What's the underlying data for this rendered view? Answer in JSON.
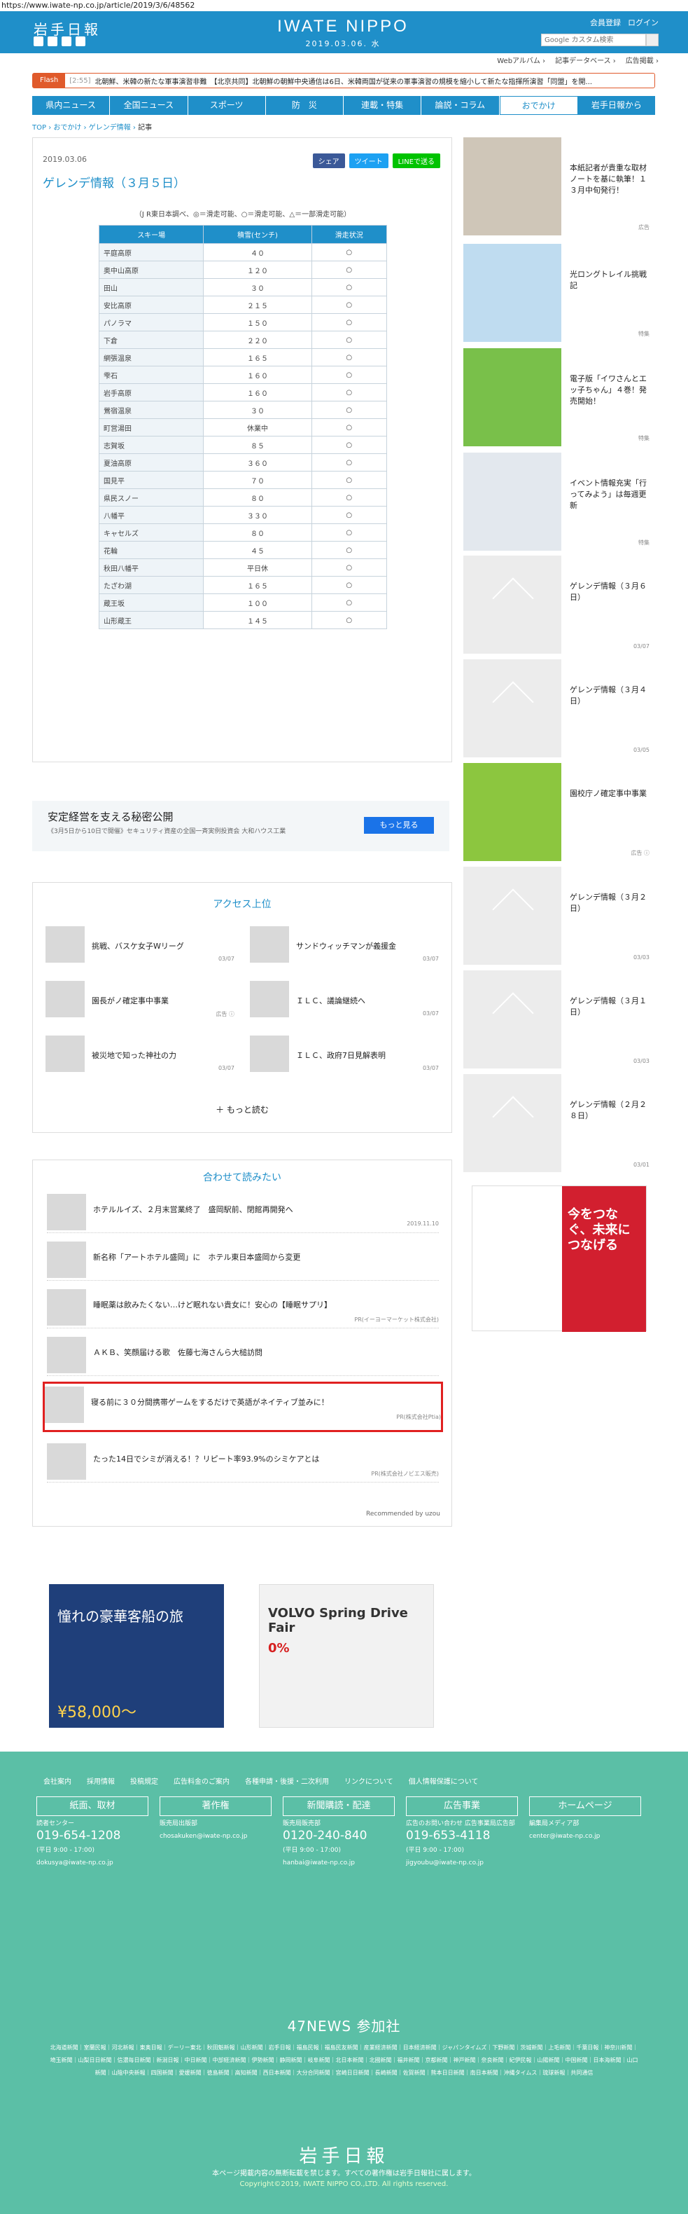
{
  "url": "https://www.iwate-np.co.jp/article/2019/3/6/48562",
  "header": {
    "logo": "岩手日報",
    "brand": "IWATE NIPPO",
    "date": "2019.03.06. 水",
    "member": "会員登録",
    "login": "ログイン",
    "search_placeholder": "Google カスタム検索",
    "subnav": [
      "Webアルバム ›",
      "記事データベース ›",
      "広告掲載 ›"
    ]
  },
  "flash": {
    "tag": "Flash",
    "time": "[2:55]",
    "text": "北朝鮮、米韓の新たな軍事演習非難　【北京共同】北朝鮮の朝鮮中央通信は6日、米韓両国が従来の軍事演習の規模を縮小して新たな指揮所演習「同盟」を開..."
  },
  "nav": [
    "県内ニュース",
    "全国ニュース",
    "スポーツ",
    "防　災",
    "連載・特集",
    "論説・コラム",
    "おでかけ",
    "岩手日報から"
  ],
  "breadcrumb": [
    "TOP",
    "おでかけ",
    "ゲレンデ情報",
    "記事"
  ],
  "article": {
    "date": "2019.03.06",
    "title": "ゲレンデ情報（３月５日）",
    "share": [
      "シェア",
      "ツイート",
      "LINEで送る"
    ],
    "note": "（J R東日本調べ、◎＝滑走可能、○＝滑走可能、△＝一部滑走可能）",
    "columns": [
      "スキー場",
      "積雪(センチ)",
      "滑走状況"
    ],
    "rows": [
      [
        "平庭高原",
        "４０",
        "○"
      ],
      [
        "奥中山高原",
        "１２０",
        "○"
      ],
      [
        "田山",
        "３０",
        "○"
      ],
      [
        "安比高原",
        "２１５",
        "○"
      ],
      [
        "パノラマ",
        "１５０",
        "○"
      ],
      [
        "下倉",
        "２２０",
        "○"
      ],
      [
        "網張温泉",
        "１６５",
        "○"
      ],
      [
        "雫石",
        "１６０",
        "○"
      ],
      [
        "岩手高原",
        "１６０",
        "○"
      ],
      [
        "鶯宿温泉",
        "３０",
        "○"
      ],
      [
        "町営湯田",
        "休業中",
        "○"
      ],
      [
        "志賀坂",
        "８５",
        "○"
      ],
      [
        "夏油高原",
        "３６０",
        "○"
      ],
      [
        "国見平",
        "７０",
        "○"
      ],
      [
        "県民スノー",
        "８０",
        "○"
      ],
      [
        "八幡平",
        "３３０",
        "○"
      ],
      [
        "キャセルズ",
        "８０",
        "○"
      ],
      [
        "花輪",
        "４５",
        "○"
      ],
      [
        "秋田八幡平",
        "平日休",
        "○"
      ],
      [
        "たざわ湖",
        "１６５",
        "○"
      ],
      [
        "蔵王坂",
        "１００",
        "○"
      ],
      [
        "山形蔵王",
        "１４５",
        "○"
      ]
    ]
  },
  "ad": {
    "headline": "安定経営を支える秘密公開",
    "sub": "《3月5日から10日で開催》セキュリティ資産の全国一斉実例投資会 大和ハウス工業",
    "cta": "もっと見る"
  },
  "ranking": {
    "title": "アクセス上位",
    "items": [
      {
        "title": "挑戦、バスケ女子Wリーグ",
        "date": "03/07"
      },
      {
        "title": "サンドウィッチマンが義援金",
        "date": "03/07"
      },
      {
        "title": "園長がノ確定事中事業",
        "date": "広告 ⓘ"
      },
      {
        "title": "ＩＬＣ、議論継続へ",
        "date": "03/07"
      },
      {
        "title": "被災地で知った神社の力",
        "date": "03/07"
      },
      {
        "title": "ＩＬＣ、政府7日見解表明",
        "date": "03/07"
      }
    ],
    "more": "＋ もっと読む"
  },
  "related": {
    "title": "合わせて読みたい",
    "items": [
      {
        "title": "ホテルルイズ、２月末営業終了　盛岡駅前、閉館再開発へ",
        "src": "2019.11.10"
      },
      {
        "title": "新名称「アートホテル盛岡」に　ホテル東日本盛岡から変更",
        "src": ""
      },
      {
        "title": "睡眠薬は飲みたくない…けど眠れない貴女に！安心の【睡眠サプリ】",
        "src": "PR(イーヨーマーケット株式会社)"
      },
      {
        "title": "ＡＫＢ、笑顔届ける歌　佐藤七海さんら大槌訪問",
        "src": ""
      },
      {
        "title": "寝る前に３０分間携帯ゲームをするだけで英語がネイティブ並みに！",
        "src": "PR(株式会社Ptia)"
      },
      {
        "title": "たった14日でシミが消える！？リピート率93.9%のシミケアとは",
        "src": "PR(株式会社ノビエス販売)"
      }
    ],
    "powered": "Recommended by uzou"
  },
  "bottom_ads": [
    {
      "title": "憧れの豪華客船の旅",
      "price": "¥58,000〜"
    },
    {
      "title": "VOLVO Spring Drive Fair",
      "price": "0%"
    }
  ],
  "sidebar": [
    {
      "title": "本紙記者が貴重な取材ノートを基に執筆！１３月中旬発行！",
      "meta": "広告"
    },
    {
      "title": "光ロングトレイル挑戦記",
      "meta": "特集"
    },
    {
      "title": "電子版「イワさんとエッ子ちゃん」４巻！発売開始！",
      "meta": "特集"
    },
    {
      "title": "イベント情報充実「行ってみよう」は毎週更新",
      "meta": "特集"
    },
    {
      "title": "ゲレンデ情報（３月６日）",
      "meta": "03/07"
    },
    {
      "title": "ゲレンデ情報（３月４日）",
      "meta": "03/05"
    },
    {
      "title": "園校庁ノ確定事中事業",
      "meta": "広告 ⓘ"
    },
    {
      "title": "ゲレンデ情報（３月２日）",
      "meta": "03/03"
    },
    {
      "title": "ゲレンデ情報（３月１日）",
      "meta": "03/03"
    },
    {
      "title": "ゲレンデ情報（２月２８日）",
      "meta": "03/01"
    }
  ],
  "side_ad": {
    "text": "今をつなぐ、未来につなげる"
  },
  "footer": {
    "links": [
      "会社案内",
      "採用情報",
      "投稿規定",
      "広告料金のご案内",
      "各種申請・後援・二次利用",
      "リンクについて",
      "個人情報保護について"
    ],
    "cols": [
      {
        "h": "紙面、取材",
        "b": "読者センター",
        "tel": "019-654-1208",
        "sub": "(平日 9:00 - 17:00)",
        "mail": "dokusya@iwate-np.co.jp"
      },
      {
        "h": "著作権",
        "b": "販売局出版部",
        "tel": "",
        "sub": "",
        "mail": "chosakuken@iwate-np.co.jp"
      },
      {
        "h": "新聞購読・配達",
        "b": "販売局販売部",
        "tel": "0120-240-840",
        "sub": "(平日 9:00 - 17:00)",
        "mail": "hanbai@iwate-np.co.jp"
      },
      {
        "h": "広告事業",
        "b": "広告のお問い合わせ 広告事業局広告部",
        "tel": "019-653-4118",
        "sub": "(平日 9:00 - 17:00)",
        "mail": "jigyoubu@iwate-np.co.jp"
      },
      {
        "h": "ホームページ",
        "b": "編集局メディア部",
        "tel": "",
        "sub": "",
        "mail": "center@iwate-np.co.jp"
      }
    ],
    "news47": "47NEWS 参加社",
    "papers": "北海道新聞｜室蘭民報｜河北新報｜東奥日報｜デーリー東北｜秋田魁新報｜山形新聞｜岩手日報｜福島民報｜福島民友新聞｜産業経済新聞｜日本経済新聞｜ジャパンタイムズ｜下野新聞｜茨城新聞｜上毛新聞｜千葉日報｜神奈川新聞｜埼玉新聞｜山梨日日新聞｜信濃毎日新聞｜新潟日報｜中日新聞｜中部経済新聞｜伊勢新聞｜静岡新聞｜岐阜新聞｜北日本新聞｜北國新聞｜福井新聞｜京都新聞｜神戸新聞｜奈良新聞｜紀伊民報｜山陽新聞｜中国新聞｜日本海新聞｜山口新聞｜山陰中央新報｜四国新聞｜愛媛新聞｜徳島新聞｜高知新聞｜西日本新聞｜大分合同新聞｜宮崎日日新聞｜長崎新聞｜佐賀新聞｜熊本日日新聞｜南日本新聞｜沖縄タイムス｜琉球新報｜共同通信",
    "logo": "岩手日報",
    "copy1": "本ページ掲載内容の無断転載を禁じます。すべての著作権は岩手日報社に属します。",
    "copy2": "Copyright©2019, IWATE NIPPO CO.,LTD. All rights reserved."
  }
}
